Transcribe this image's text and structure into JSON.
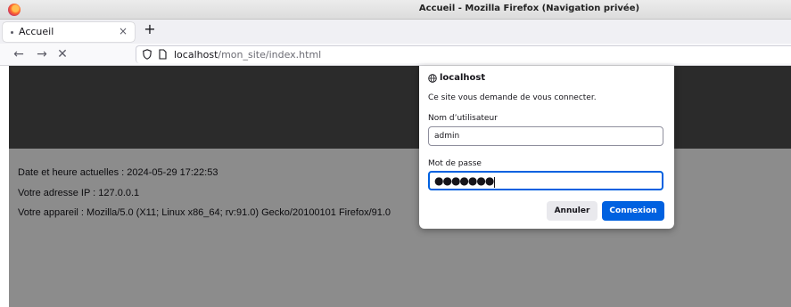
{
  "window": {
    "title": "Accueil - Mozilla Firefox (Navigation privée)"
  },
  "tabs": [
    {
      "label": "Accueil",
      "close": "×"
    }
  ],
  "new_tab": "+",
  "nav": {
    "back": "←",
    "forward": "→",
    "stop": "✕"
  },
  "address": {
    "host": "localhost",
    "path": "/mon_site/index.html"
  },
  "page": {
    "lines": [
      "Date et heure actuelles : 2024-05-29 17:22:53",
      "Votre adresse IP : 127.0.0.1",
      "Votre appareil : Mozilla/5.0 (X11; Linux x86_64; rv:91.0) Gecko/20100101 Firefox/91.0"
    ]
  },
  "auth_dialog": {
    "host": "localhost",
    "message": "Ce site vous demande de vous connecter.",
    "username_label": "Nom d’utilisateur",
    "username_value": "admin",
    "password_label": "Mot de passe",
    "password_mask": "●●●●●●●",
    "cancel_label": "Annuler",
    "login_label": "Connexion",
    "accent_color": "#0061e0"
  },
  "icons": [
    "firefox-logo",
    "tab-dot-icon",
    "close-icon",
    "plus-icon",
    "back-arrow-icon",
    "forward-arrow-icon",
    "stop-icon",
    "shield-icon",
    "page-icon",
    "globe-icon"
  ]
}
